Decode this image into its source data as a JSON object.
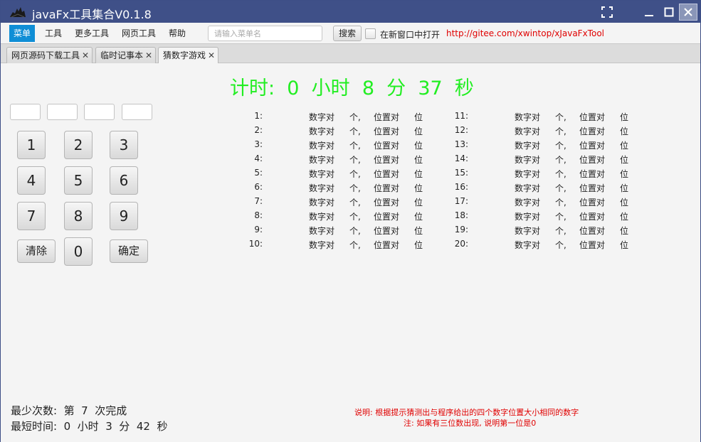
{
  "window": {
    "title": "javaFx工具集合V0.1.8",
    "icons": {
      "app": "app-logo-icon",
      "fullscreen": "fullscreen-icon",
      "minimize": "minimize-icon",
      "maximize": "maximize-icon",
      "close": "close-icon"
    }
  },
  "menubar": {
    "items": [
      "菜单",
      "工具",
      "更多工具",
      "网页工具",
      "帮助"
    ],
    "search_placeholder": "请输入菜单名",
    "search_label": "搜索",
    "open_new_window_label": "在新窗口中打开",
    "open_new_window_checked": false,
    "link": "http://gitee.com/xwintop/xJavaFxTool"
  },
  "tabs": [
    {
      "label": "网页源码下载工具",
      "close": "✕"
    },
    {
      "label": "临时记事本",
      "close": "✕"
    },
    {
      "label": "猜数字游戏",
      "close": "✕",
      "selected": true
    }
  ],
  "game": {
    "timer": {
      "prefix": "计时:",
      "hours": "0",
      "hours_unit": "小时",
      "minutes": "8",
      "minutes_unit": "分",
      "seconds": "37",
      "seconds_unit": "秒"
    },
    "guess_inputs": [
      "",
      "",
      "",
      ""
    ],
    "keypad": [
      {
        "label": "1"
      },
      {
        "label": "2"
      },
      {
        "label": "3"
      },
      {
        "label": "4"
      },
      {
        "label": "5"
      },
      {
        "label": "6"
      },
      {
        "label": "7"
      },
      {
        "label": "8"
      },
      {
        "label": "9"
      },
      {
        "label": "清除"
      },
      {
        "label": "0"
      },
      {
        "label": "确定"
      }
    ],
    "results_left": [
      {
        "index": "1:",
        "digits": "数字对",
        "digits_unit": "个,",
        "position": "位置对",
        "position_unit": "位"
      },
      {
        "index": "2:",
        "digits": "数字对",
        "digits_unit": "个,",
        "position": "位置对",
        "position_unit": "位"
      },
      {
        "index": "3:",
        "digits": "数字对",
        "digits_unit": "个,",
        "position": "位置对",
        "position_unit": "位"
      },
      {
        "index": "4:",
        "digits": "数字对",
        "digits_unit": "个,",
        "position": "位置对",
        "position_unit": "位"
      },
      {
        "index": "5:",
        "digits": "数字对",
        "digits_unit": "个,",
        "position": "位置对",
        "position_unit": "位"
      },
      {
        "index": "6:",
        "digits": "数字对",
        "digits_unit": "个,",
        "position": "位置对",
        "position_unit": "位"
      },
      {
        "index": "7:",
        "digits": "数字对",
        "digits_unit": "个,",
        "position": "位置对",
        "position_unit": "位"
      },
      {
        "index": "8:",
        "digits": "数字对",
        "digits_unit": "个,",
        "position": "位置对",
        "position_unit": "位"
      },
      {
        "index": "9:",
        "digits": "数字对",
        "digits_unit": "个,",
        "position": "位置对",
        "position_unit": "位"
      },
      {
        "index": "10:",
        "digits": "数字对",
        "digits_unit": "个,",
        "position": "位置对",
        "position_unit": "位"
      }
    ],
    "results_right": [
      {
        "index": "11:",
        "digits": "数字对",
        "digits_unit": "个,",
        "position": "位置对",
        "position_unit": "位"
      },
      {
        "index": "12:",
        "digits": "数字对",
        "digits_unit": "个,",
        "position": "位置对",
        "position_unit": "位"
      },
      {
        "index": "13:",
        "digits": "数字对",
        "digits_unit": "个,",
        "position": "位置对",
        "position_unit": "位"
      },
      {
        "index": "14:",
        "digits": "数字对",
        "digits_unit": "个,",
        "position": "位置对",
        "position_unit": "位"
      },
      {
        "index": "15:",
        "digits": "数字对",
        "digits_unit": "个,",
        "position": "位置对",
        "position_unit": "位"
      },
      {
        "index": "16:",
        "digits": "数字对",
        "digits_unit": "个,",
        "position": "位置对",
        "position_unit": "位"
      },
      {
        "index": "17:",
        "digits": "数字对",
        "digits_unit": "个,",
        "position": "位置对",
        "position_unit": "位"
      },
      {
        "index": "18:",
        "digits": "数字对",
        "digits_unit": "个,",
        "position": "位置对",
        "position_unit": "位"
      },
      {
        "index": "19:",
        "digits": "数字对",
        "digits_unit": "个,",
        "position": "位置对",
        "position_unit": "位"
      },
      {
        "index": "20:",
        "digits": "数字对",
        "digits_unit": "个,",
        "position": "位置对",
        "position_unit": "位"
      }
    ],
    "best_attempts": "最少次数:  第  7  次完成",
    "best_time": "最短时间:  0  小时  3  分  42  秒",
    "note_line1": "说明: 根据提示猜测出与程序给出的四个数字位置大小相同的数字",
    "note_line2": "注: 如果有三位数出现, 说明第一位是0"
  },
  "colors": {
    "titlebar": "#3f5088",
    "menu_active": "#0f8ed6",
    "timer": "#22ee22",
    "link": "#e00000",
    "note": "#e00000"
  }
}
